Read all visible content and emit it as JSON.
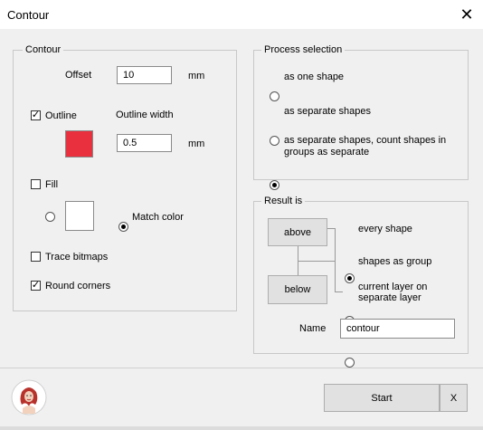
{
  "window": {
    "title": "Contour",
    "close_glyph": "✕"
  },
  "contour": {
    "legend": "Contour",
    "offset_label": "Offset",
    "offset_value": "10",
    "offset_unit": "mm",
    "outline_label": "Outline",
    "outline_checked": true,
    "outline_width_label": "Outline width",
    "outline_width_value": "0.5",
    "outline_width_unit": "mm",
    "outline_color": "#e8303f",
    "fill_label": "Fill",
    "fill_checked": false,
    "fill_color": "#ffffff",
    "match_color_label": "Match color",
    "trace_bitmaps_label": "Trace bitmaps",
    "trace_bitmaps_checked": false,
    "round_corners_label": "Round corners",
    "round_corners_checked": true
  },
  "process": {
    "legend": "Process selection",
    "options": [
      {
        "label": "as one shape",
        "selected": false
      },
      {
        "label": "as separate shapes",
        "selected": false
      },
      {
        "label_line1": "as separate shapes, count shapes in",
        "label_line2": "groups as separate",
        "selected": true
      }
    ]
  },
  "result": {
    "legend": "Result is",
    "above_label": "above",
    "below_label": "below",
    "options": [
      {
        "label": "every shape",
        "selected": true
      },
      {
        "label": "shapes as group",
        "selected": false
      },
      {
        "label_line1": "current layer on",
        "label_line2": "separate layer",
        "selected": false
      }
    ],
    "name_label": "Name",
    "name_value": "contour"
  },
  "footer": {
    "start_label": "Start",
    "x_label": "X",
    "logo_icon": "logo-icon"
  }
}
